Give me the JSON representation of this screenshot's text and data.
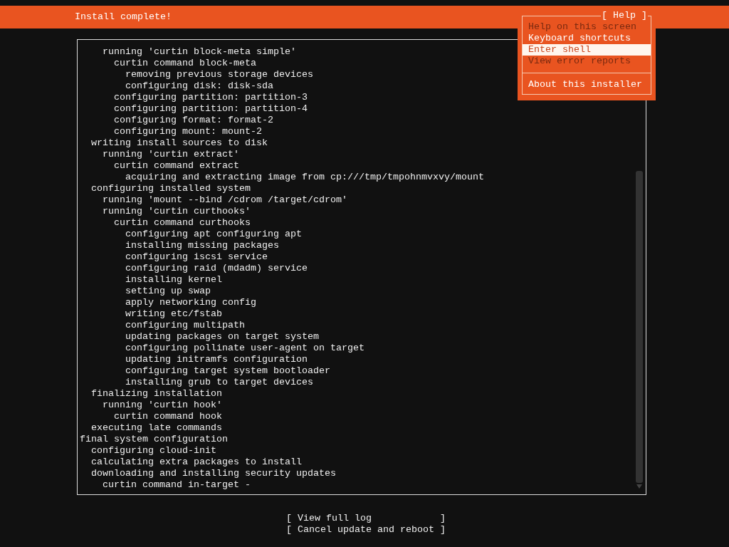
{
  "header": {
    "title": "Install complete!"
  },
  "help_menu": {
    "title": "[ Help ]",
    "items": [
      {
        "label": "Help on this screen",
        "disabled": true,
        "selected": false
      },
      {
        "label": "Keyboard shortcuts",
        "disabled": false,
        "selected": false
      },
      {
        "label": "Enter shell",
        "disabled": false,
        "selected": true
      },
      {
        "label": "View error reports",
        "disabled": true,
        "selected": false
      }
    ],
    "footer_items": [
      {
        "label": "About this installer",
        "disabled": false,
        "selected": false
      }
    ]
  },
  "log": [
    {
      "children": [
        {
          "children": [
            {
              "text": "running 'curtin block-meta simple'",
              "children": [
                {
                  "text": "curtin command block-meta",
                  "children": [
                    {
                      "text": "removing previous storage devices"
                    },
                    {
                      "text": "configuring disk: disk-sda"
                    }
                  ]
                },
                {
                  "text": "configuring partition: partition-3"
                },
                {
                  "text": "configuring partition: partition-4"
                },
                {
                  "text": "configuring format: format-2"
                },
                {
                  "text": "configuring mount: mount-2"
                }
              ]
            }
          ]
        },
        {
          "text": "writing install sources to disk",
          "children": [
            {
              "text": "running 'curtin extract'",
              "children": [
                {
                  "text": "curtin command extract",
                  "children": [
                    {
                      "text": "acquiring and extracting image from cp:///tmp/tmpohnmvxvy/mount"
                    }
                  ]
                }
              ]
            }
          ]
        },
        {
          "text": "configuring installed system",
          "children": [
            {
              "text": "running 'mount --bind /cdrom /target/cdrom'"
            },
            {
              "text": "running 'curtin curthooks'",
              "children": [
                {
                  "text": "curtin command curthooks",
                  "children": [
                    {
                      "text": "configuring apt configuring apt"
                    },
                    {
                      "text": "installing missing packages"
                    },
                    {
                      "text": "configuring iscsi service"
                    },
                    {
                      "text": "configuring raid (mdadm) service"
                    },
                    {
                      "text": "installing kernel"
                    },
                    {
                      "text": "setting up swap"
                    },
                    {
                      "text": "apply networking config"
                    },
                    {
                      "text": "writing etc/fstab"
                    },
                    {
                      "text": "configuring multipath"
                    },
                    {
                      "text": "updating packages on target system"
                    },
                    {
                      "text": "configuring pollinate user-agent on target"
                    },
                    {
                      "text": "updating initramfs configuration"
                    },
                    {
                      "text": "configuring target system bootloader"
                    },
                    {
                      "text": "installing grub to target devices"
                    }
                  ]
                }
              ]
            }
          ]
        },
        {
          "text": "finalizing installation",
          "children": [
            {
              "text": "running 'curtin hook'",
              "children": [
                {
                  "text": "curtin command hook"
                }
              ]
            }
          ]
        },
        {
          "text": "executing late commands"
        }
      ]
    },
    {
      "text": "final system configuration",
      "children": [
        {
          "text": "configuring cloud-init"
        },
        {
          "text": "calculating extra packages to install"
        },
        {
          "text": "downloading and installing security updates",
          "children": [
            {
              "text": "curtin command in-target -"
            }
          ]
        }
      ]
    }
  ],
  "buttons": [
    {
      "label": "[ View full log            ]"
    },
    {
      "label": "[ Cancel update and reboot ]"
    }
  ]
}
